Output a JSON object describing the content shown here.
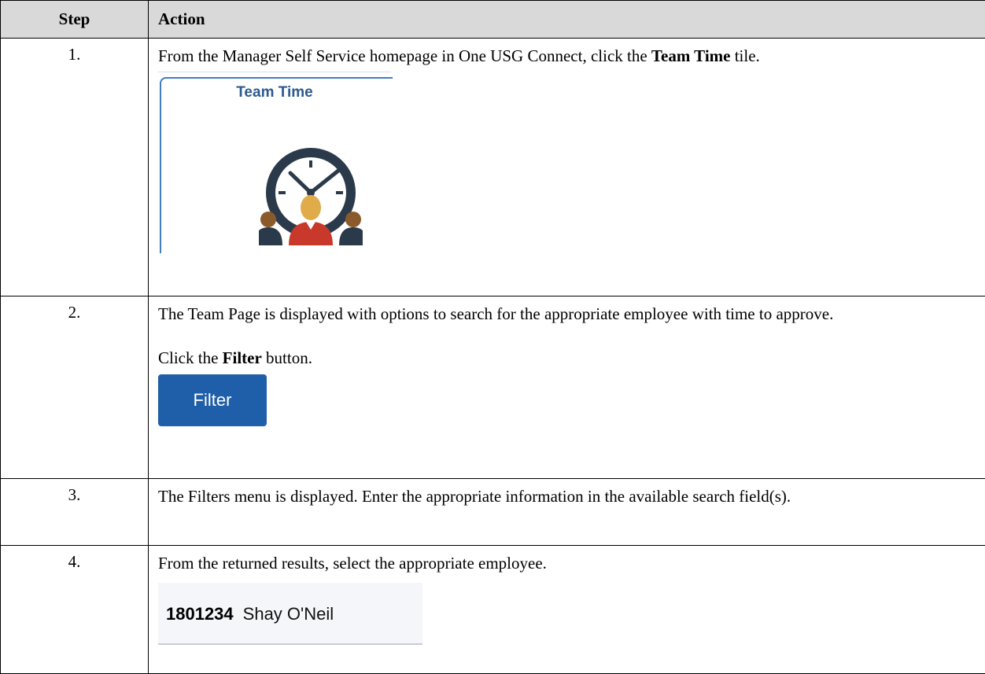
{
  "table": {
    "header_step": "Step",
    "header_action": "Action"
  },
  "rows": [
    {
      "step": "1.",
      "text_before": "From the Manager Self Service homepage in One USG Connect, click the ",
      "bold": "Team Time",
      "text_after": " tile."
    },
    {
      "step": "2.",
      "para1": "The Team Page is displayed with options to search for the appropriate employee with time to approve.",
      "text_before": "Click the ",
      "bold": "Filter",
      "text_after": " button."
    },
    {
      "step": "3.",
      "text": "The Filters menu is displayed. Enter the appropriate information in the available search field(s)."
    },
    {
      "step": "4.",
      "text": "From the returned results, select the appropriate employee."
    }
  ],
  "tile": {
    "title": "Team Time",
    "icon": "clock-team-icon"
  },
  "filter_button": {
    "label": "Filter"
  },
  "employee": {
    "id": "1801234",
    "name": "Shay O'Neil"
  },
  "colors": {
    "header_bg": "#d9d9d9",
    "tile_title": "#2c5a8e",
    "tile_border": "#3f7cc1",
    "filter_bg": "#1f5ea8",
    "clock_dark": "#2b3a4a",
    "person_gold": "#e0ac4a",
    "person_red": "#c8392b",
    "person_brown": "#8b5a2b"
  }
}
